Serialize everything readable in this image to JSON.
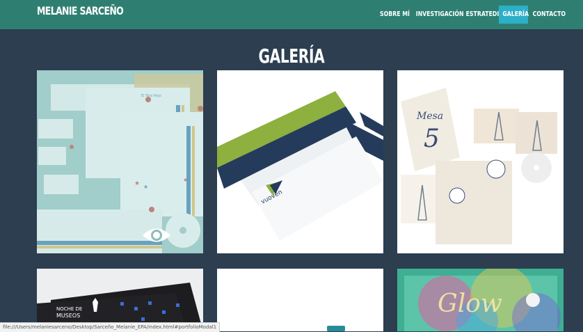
{
  "navbar": {
    "brand": "MELANIE SARCEÑO",
    "items": [
      {
        "label": "SOBRE MÍ",
        "active": false
      },
      {
        "label": "INVESTIGACIÓN",
        "active": false
      },
      {
        "label": "ESTRATEDIA",
        "active": false
      },
      {
        "label": "GALERÍA",
        "active": true
      },
      {
        "label": "CONTACTO",
        "active": false
      }
    ]
  },
  "main": {
    "title": "GALERÍA"
  },
  "portfolio": {
    "card1": {
      "logo_text": "El Toro Rojo",
      "hover_icon": "eye-icon"
    },
    "card2": {
      "logo_text": "vuoven"
    },
    "card3": {
      "table_label": "Mesa",
      "table_number": "5"
    },
    "card4": {
      "logo_line1": "NOCHE DE",
      "logo_line2": "MUSEOS"
    },
    "card6": {
      "script_text": "Glow"
    }
  },
  "status_bar": {
    "url": "file:///Users/melaniesarceno/Desktop/Sarceño_Melanie_EPA/index.html#portfolioModal1"
  },
  "colors": {
    "navbar": "#2e7f72",
    "background": "#2c3e50",
    "active_nav": "#2dafc7"
  }
}
